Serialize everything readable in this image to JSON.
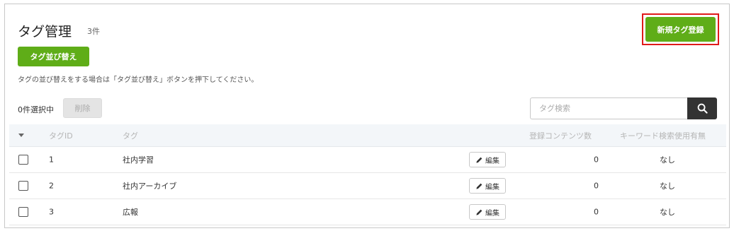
{
  "page": {
    "title": "タグ管理",
    "count": "3件",
    "new_button": "新規タグ登録",
    "sort_button": "タグ並び替え",
    "note": "タグの並び替えをする場合は「タグ並び替え」ボタンを押下してください。"
  },
  "toolbar": {
    "selected_count": "0件選択中",
    "delete_button": "削除",
    "search_placeholder": "タグ検索"
  },
  "table": {
    "headers": {
      "id": "タグID",
      "tag": "タグ",
      "contents": "登録コンテンツ数",
      "keyword": "キーワード検索使用有無"
    },
    "edit_label": "編集",
    "rows": [
      {
        "id": "1",
        "tag": "社内学習",
        "contents": "0",
        "keyword": "なし"
      },
      {
        "id": "2",
        "tag": "社内アーカイブ",
        "contents": "0",
        "keyword": "なし"
      },
      {
        "id": "3",
        "tag": "広報",
        "contents": "0",
        "keyword": "なし"
      }
    ]
  },
  "icons": {
    "search": "search-icon",
    "edit": "pencil-icon",
    "sort": "caret-down-icon"
  },
  "colors": {
    "primary": "#5fad18",
    "highlight": "#e01a1a",
    "search_button": "#333333",
    "header_bg": "#f3f6f9"
  }
}
